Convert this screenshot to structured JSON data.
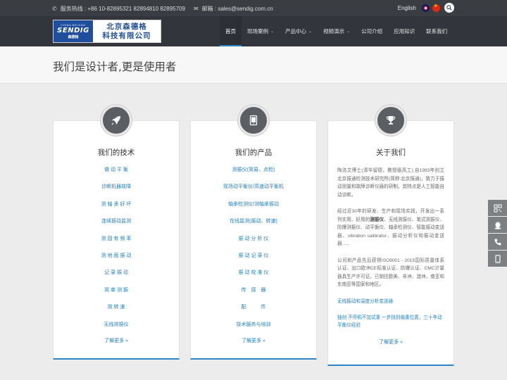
{
  "topbar": {
    "phone_icon": "phone-icon",
    "phone_text": "服务热线 : +86 10-82895321 82894810 82895709",
    "mail_icon": "mail-icon",
    "mail_text": "邮箱 : sales@sendig.com.cn",
    "lang_label": "English"
  },
  "logo": {
    "brand_sub": "CHINA BEIJING",
    "brand": "SENDIG",
    "brand_cn": "森德格",
    "name_line1": "北京森德格",
    "name_line2": "科技有限公司"
  },
  "nav": {
    "items": [
      {
        "label": "首页",
        "caret": false
      },
      {
        "label": "现场案例",
        "caret": true
      },
      {
        "label": "产品中心",
        "caret": true
      },
      {
        "label": "视频演示",
        "caret": true
      },
      {
        "label": "公司介绍",
        "caret": false
      },
      {
        "label": "应用知识",
        "caret": false
      },
      {
        "label": "联系我们",
        "caret": false
      }
    ],
    "active_index": 0
  },
  "hero": {
    "title": "我们是设计者,更是使用者"
  },
  "cards": {
    "tech": {
      "icon": "rocket-icon",
      "title": "我们的技术",
      "items": [
        "做 动 平 衡",
        "诊断机器故障",
        "测 轴 承 好 坏",
        "连续振动监测",
        "测 固 有 频 率",
        "测 地 面 振 动",
        "记 录 振 动",
        "简 单 测 振",
        "测  转  速",
        "无线测振仪"
      ],
      "more": "了解更多 »"
    },
    "products": {
      "icon": "tablet-icon",
      "title": "我们的产品",
      "items": [
        "测振仪(简易、点检)",
        "现场动平衡仪/高速动平衡机",
        "轴承检测仪/测轴承振动",
        "在线监测(振动、转速)",
        "振 动 分 析 仪",
        "振 动 记 录 仪",
        "振 动 校 准 仪",
        "传　感　器",
        "配　　　件",
        "技术服务与培训"
      ],
      "more": "了解更多 »"
    },
    "about": {
      "icon": "trophy-icon",
      "title": "关于我们",
      "p1": "陶洛文博士(清华留德，教授级高工),自1993年创立北京振通检测技术研究所(简称:北京振通)，致力于振动测量和故障诊断仪器的研制。其特点是人工智能自动诊断。",
      "p2_pre": "经过近30年的研发、生产和现场实践，开发出一系列实用、好用的",
      "p2_bold": "测振仪",
      "p2_post": "、无线测振仪、笔式测振仪、防爆测振仪、动平衡仪、轴承检测仪、智能振动变送器、vibration calibrator、振动分析仪和振动变送器......",
      "p3": "公司和产品先后获得ISO9001 - 2015国际质量体系认证、出口欧洲CE标准认证、防爆认证、CMC计量器具生产许可证，已销往欧美、非洲、澳洲，南亚和东南亚等国家和地区。",
      "link1": "无线振动和温度分析变送器",
      "link2": "独创 不停机不加试重 一步找到偏重位置，三十年动平衡仪经验",
      "more": "了解更多 »"
    }
  },
  "tools": [
    "qrcode-icon",
    "chat-icon",
    "phone-icon",
    "mobile-icon"
  ],
  "colors": {
    "accent": "#2d87c6",
    "link": "#1d7fc0",
    "header_bg": "#32363c",
    "topbar_bg": "#3a3d42"
  }
}
